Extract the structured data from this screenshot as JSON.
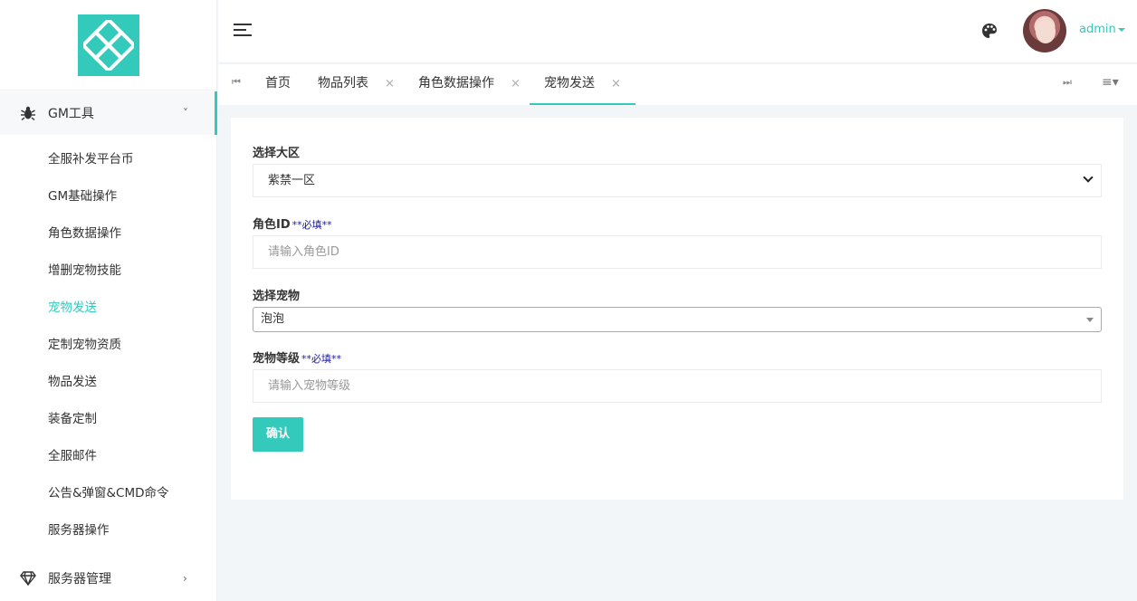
{
  "colors": {
    "accent": "#33cabb",
    "required": "#1a1aa6"
  },
  "sidebar": {
    "groups": [
      {
        "label": "GM工具",
        "icon": "bug-icon",
        "caret": "˅"
      },
      {
        "label": "服务器管理",
        "icon": "diamond-icon",
        "caret": "›"
      }
    ],
    "items": [
      {
        "label": "全服补发平台币"
      },
      {
        "label": "GM基础操作"
      },
      {
        "label": "角色数据操作"
      },
      {
        "label": "增删宠物技能"
      },
      {
        "label": "宠物发送"
      },
      {
        "label": "定制宠物资质"
      },
      {
        "label": "物品发送"
      },
      {
        "label": "装备定制"
      },
      {
        "label": "全服邮件"
      },
      {
        "label": "公告&弹窗&CMD命令"
      },
      {
        "label": "服务器操作"
      }
    ]
  },
  "header": {
    "username": "admin"
  },
  "tabs": {
    "prev_glyph": "⏮",
    "next_glyph": "⏭",
    "close_glyph": "×",
    "menu_glyph": "≡▾",
    "items": [
      {
        "label": "首页"
      },
      {
        "label": "物品列表"
      },
      {
        "label": "角色数据操作"
      },
      {
        "label": "宠物发送"
      }
    ]
  },
  "form": {
    "region": {
      "label": "选择大区",
      "value": "紫禁一区"
    },
    "role_id": {
      "label": "角色ID",
      "required": "**必填**",
      "placeholder": "请输入角色ID"
    },
    "pet": {
      "label": "选择宠物",
      "value": "泡泡"
    },
    "pet_level": {
      "label": "宠物等级",
      "required": "**必填**",
      "placeholder": "请输入宠物等级"
    },
    "submit_label": "确认"
  }
}
